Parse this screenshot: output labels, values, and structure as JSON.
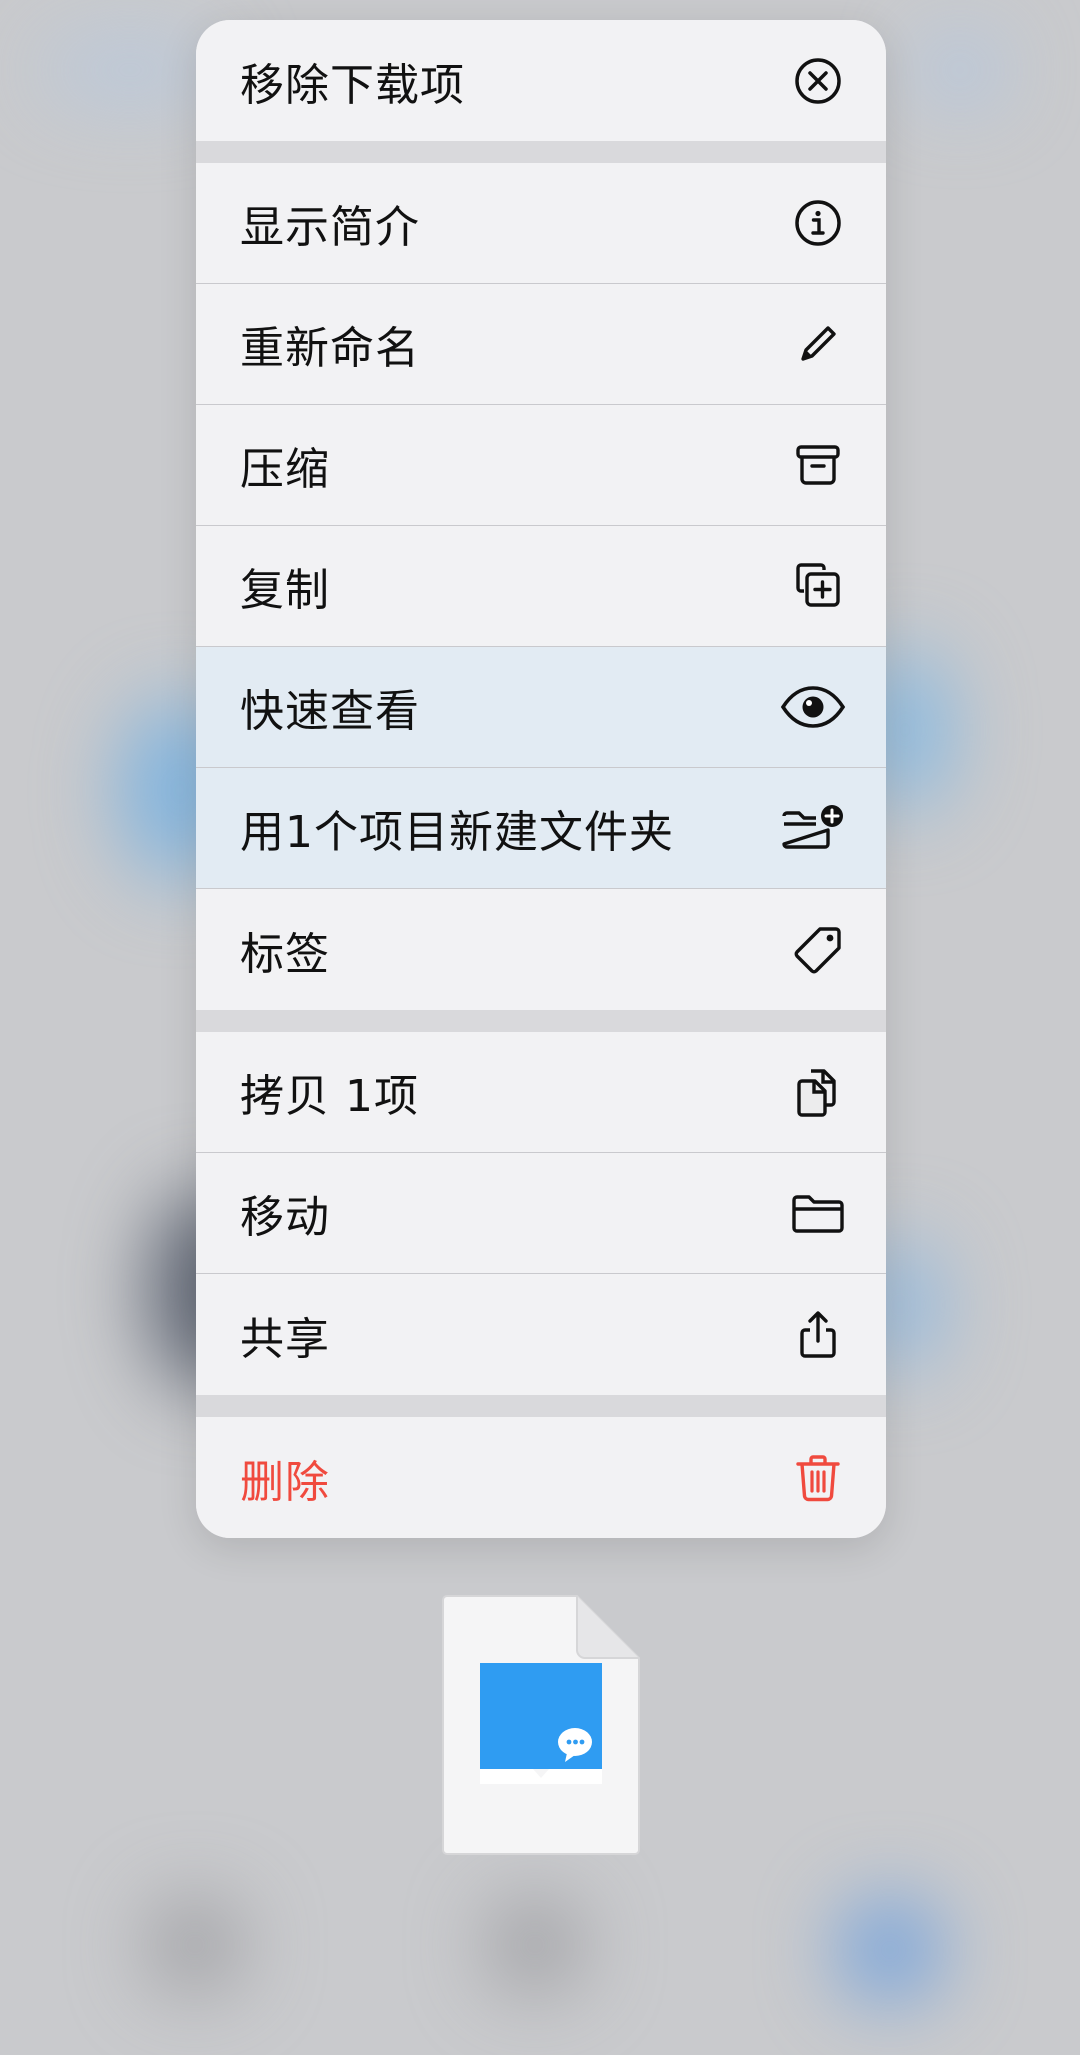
{
  "menu": {
    "groups": [
      [
        {
          "label": "移除下载项",
          "icon": "remove-download-icon"
        }
      ],
      [
        {
          "label": "显示简介",
          "icon": "info-icon"
        },
        {
          "label": "重新命名",
          "icon": "pencil-icon"
        },
        {
          "label": "压缩",
          "icon": "archive-box-icon"
        },
        {
          "label": "复制",
          "icon": "duplicate-icon"
        },
        {
          "label": "快速查看",
          "icon": "eye-icon"
        },
        {
          "label": "用1个项目新建文件夹",
          "icon": "folder-badge-plus-icon"
        },
        {
          "label": "标签",
          "icon": "tag-icon"
        }
      ],
      [
        {
          "label": "拷贝 1项",
          "icon": "copy-docs-icon"
        },
        {
          "label": "移动",
          "icon": "folder-icon"
        },
        {
          "label": "共享",
          "icon": "share-icon"
        }
      ],
      [
        {
          "label": "删除",
          "icon": "trash-icon"
        }
      ]
    ]
  },
  "colors": {
    "danger": "#f04a3e",
    "file_accent": "#2f9cf2"
  },
  "file_preview": {
    "icon": "wechat-file-icon"
  }
}
